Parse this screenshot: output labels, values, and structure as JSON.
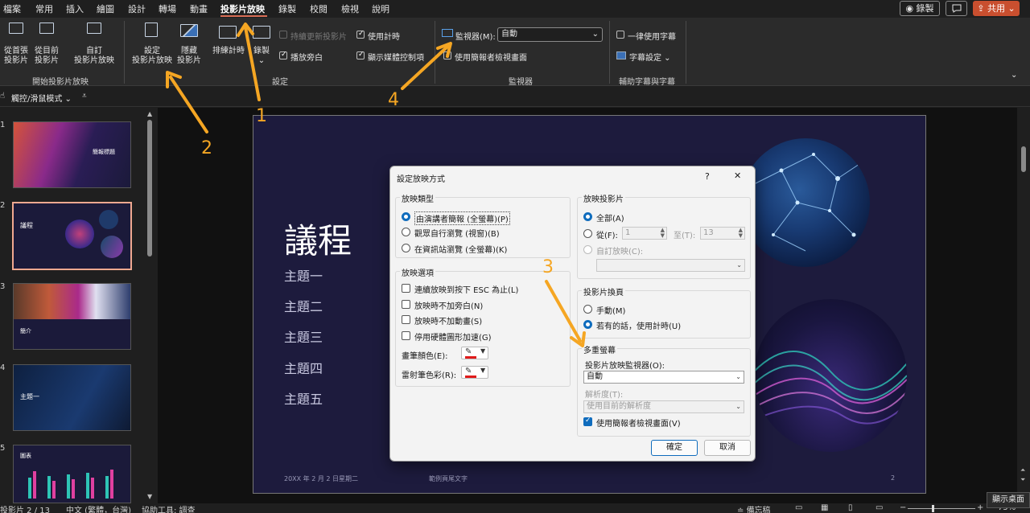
{
  "menubar": {
    "items": [
      "檔案",
      "常用",
      "插入",
      "繪圖",
      "設計",
      "轉場",
      "動畫",
      "投影片放映",
      "錄製",
      "校閱",
      "檢視",
      "說明"
    ],
    "record_button": "◉ 錄製",
    "comment_icon": "comment-icon",
    "share_button": "共用",
    "accent": "#d86d55"
  },
  "ribbon": {
    "start_group": {
      "from_first": "從首張\n投影片",
      "from_first_l1": "從首張",
      "from_first_l2": "投影片",
      "from_current_l1": "從目前",
      "from_current_l2": "投影片",
      "custom_l1": "自訂",
      "custom_l2": "投影片放映",
      "label": "開始投影片放映"
    },
    "setup_group": {
      "setup_l1": "設定",
      "setup_l2": "投影片放映",
      "hide_l1": "隱藏",
      "hide_l2": "投影片",
      "rehearse": "排練計時",
      "record_l1": "錄製",
      "keep_updated": "持續更新投影片",
      "use_timings": "使用計時",
      "play_narrations": "播放旁白",
      "show_media_controls": "顯示媒體控制項",
      "label": "設定"
    },
    "monitors_group": {
      "monitor_label": "監視器(M):",
      "monitor_value": "自動",
      "presenter_view": "使用簡報者檢視畫面",
      "label": "監視器"
    },
    "captions_group": {
      "always_subtitles": "一律使用字幕",
      "subtitle_settings": "字幕設定",
      "label": "輔助字幕與字幕"
    }
  },
  "quick_access": {
    "touch_mode": "觸控/滑鼠模式"
  },
  "thumbnails": {
    "numbers": [
      "1",
      "2",
      "3",
      "4",
      "5"
    ],
    "slide1_title": "簡報標題",
    "slide2_title": "議程",
    "slide3_title": "簡介",
    "slide4_title": "主題一",
    "slide5_title": "圖表"
  },
  "slide": {
    "title": "議程",
    "items": [
      "主題一",
      "主題二",
      "主題三",
      "主題四",
      "主題五"
    ],
    "footer_date": "20XX 年 2 月 2 日星期二",
    "footer_text": "範例頁尾文字",
    "page_number": "2"
  },
  "dialog": {
    "title": "設定放映方式",
    "help": "?",
    "close": "✕",
    "show_type": {
      "label": "放映類型",
      "options": [
        "由演講者簡報 (全螢幕)(P)",
        "觀眾自行瀏覽 (視窗)(B)",
        "在資訊站瀏覽 (全螢幕)(K)"
      ]
    },
    "show_options": {
      "label": "放映選項",
      "checks": [
        "連續放映到按下 ESC 為止(L)",
        "放映時不加旁白(N)",
        "放映時不加動畫(S)",
        "停用硬體圖形加速(G)"
      ],
      "pen_color": "畫筆顏色(E):",
      "laser_color": "雷射筆色彩(R):"
    },
    "show_slides": {
      "label": "放映投影片",
      "all": "全部(A)",
      "from": "從(F):",
      "from_value": "1",
      "to": "至(T):",
      "to_value": "13",
      "custom_show": "自訂放映(C):"
    },
    "advance": {
      "label": "投影片換頁",
      "manual": "手動(M)",
      "timings": "若有的話，使用計時(U)"
    },
    "multi_monitor": {
      "label": "多重螢幕",
      "monitor_label": "投影片放映監視器(O):",
      "monitor_value": "自動",
      "resolution_label": "解析度(T):",
      "resolution_value": "使用目前的解析度",
      "presenter_view": "使用簡報者檢視畫面(V)"
    },
    "ok": "確定",
    "cancel": "取消",
    "accent": "#0f6cbd"
  },
  "annotations": [
    "1",
    "2",
    "3",
    "4"
  ],
  "status": {
    "slide_count": "投影片 2 / 13",
    "language": "中文 (繁體，台灣)",
    "accessibility": "協助工具: 調查",
    "notes": "備忘稿",
    "zoom": "75%",
    "tooltip": "顯示桌面"
  }
}
